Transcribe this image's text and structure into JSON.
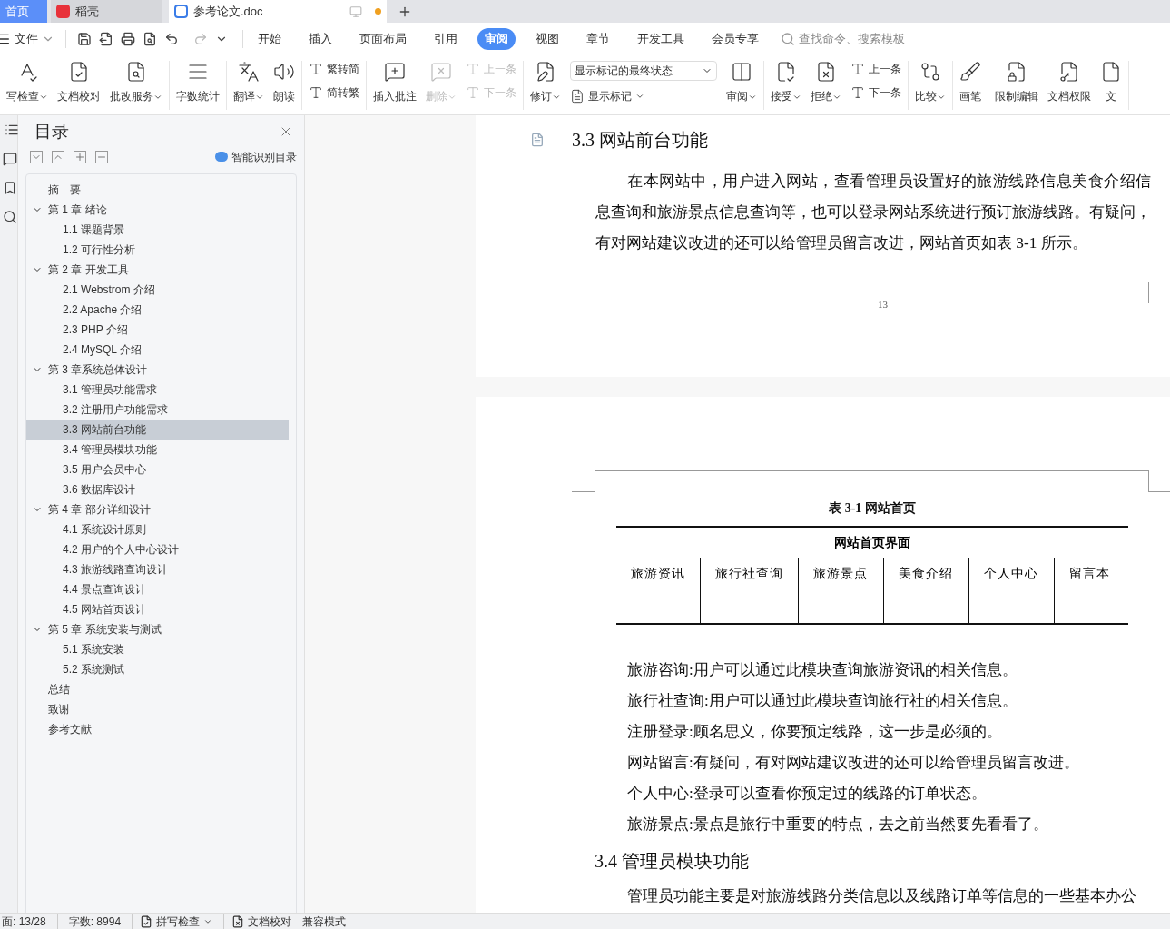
{
  "tabs": [
    {
      "label": "首页",
      "kind": "home",
      "selected": false
    },
    {
      "label": "稻壳",
      "kind": "app",
      "selected": false
    },
    {
      "label": "参考论文.doc",
      "kind": "doc",
      "selected": true
    }
  ],
  "menu": {
    "file": "文件",
    "tabs": [
      {
        "label": "开始",
        "selected": false
      },
      {
        "label": "插入",
        "selected": false
      },
      {
        "label": "页面布局",
        "selected": false
      },
      {
        "label": "引用",
        "selected": false
      },
      {
        "label": "审阅",
        "selected": true
      },
      {
        "label": "视图",
        "selected": false
      },
      {
        "label": "章节",
        "selected": false
      },
      {
        "label": "开发工具",
        "selected": false
      },
      {
        "label": "会员专享",
        "selected": false
      }
    ],
    "search": {
      "placeholder": "查找命令、搜索模板"
    }
  },
  "ribbon": [
    [
      {
        "kind": "big",
        "label": "写检查",
        "caret": true,
        "disabled": false
      },
      {
        "kind": "big",
        "label": "文档校对",
        "caret": false,
        "disabled": false
      },
      {
        "kind": "big",
        "label": "批改服务",
        "caret": true,
        "disabled": false
      }
    ],
    [
      {
        "kind": "big",
        "label": "字数统计",
        "caret": false,
        "disabled": false
      }
    ],
    [
      {
        "kind": "big",
        "label": "翻译",
        "caret": true,
        "disabled": false
      },
      {
        "kind": "big",
        "label": "朗读",
        "caret": false,
        "disabled": false
      }
    ],
    [
      {
        "kind": "stack",
        "items": [
          {
            "label": "繁转简",
            "disabled": false
          },
          {
            "label": "简转繁",
            "disabled": false
          }
        ]
      }
    ],
    [
      {
        "kind": "big",
        "label": "插入批注",
        "caret": false,
        "disabled": false
      },
      {
        "kind": "big",
        "label": "删除",
        "caret": true,
        "disabled": true
      },
      {
        "kind": "stack",
        "items": [
          {
            "label": "上一条",
            "disabled": true
          },
          {
            "label": "下一条",
            "disabled": true
          }
        ]
      }
    ],
    [
      {
        "kind": "big",
        "label": "修订",
        "caret": true,
        "disabled": false
      },
      {
        "kind": "select",
        "value": "显示标记的最终状态",
        "below": "显示标记"
      },
      {
        "kind": "big",
        "label": "审阅",
        "caret": true,
        "disabled": false
      }
    ],
    [
      {
        "kind": "big",
        "label": "接受",
        "caret": true,
        "disabled": false
      },
      {
        "kind": "big",
        "label": "拒绝",
        "caret": true,
        "disabled": false
      },
      {
        "kind": "stack",
        "items": [
          {
            "label": "上一条",
            "disabled": false
          },
          {
            "label": "下一条",
            "disabled": false
          }
        ]
      }
    ],
    [
      {
        "kind": "big",
        "label": "比较",
        "caret": true,
        "disabled": false
      }
    ],
    [
      {
        "kind": "big",
        "label": "画笔",
        "caret": false,
        "disabled": false
      }
    ],
    [
      {
        "kind": "big",
        "label": "限制编辑",
        "caret": false,
        "disabled": false
      },
      {
        "kind": "big",
        "label": "文档权限",
        "caret": false,
        "disabled": false
      },
      {
        "kind": "big",
        "label": "文",
        "caret": false,
        "disabled": false
      }
    ]
  ],
  "toc": {
    "title": "目录",
    "smart": "智能识别目录",
    "items": [
      {
        "label": "摘　要",
        "selected": false
      },
      {
        "label": "第 1 章  绪论",
        "expanded": true,
        "selected": false,
        "children": [
          {
            "label": "1.1  课题背景",
            "selected": false
          },
          {
            "label": "1.2  可行性分析",
            "selected": false
          }
        ]
      },
      {
        "label": "第 2 章  开发工具",
        "expanded": true,
        "selected": false,
        "children": [
          {
            "label": "2.1 Webstrom 介绍",
            "selected": false
          },
          {
            "label": "2.2 Apache 介绍",
            "selected": false
          },
          {
            "label": "2.3    PHP 介绍",
            "selected": false
          },
          {
            "label": "2.4 MySQL 介绍",
            "selected": false
          }
        ]
      },
      {
        "label": "第 3 章系统总体设计",
        "expanded": true,
        "selected": false,
        "children": [
          {
            "label": "3.1  管理员功能需求",
            "selected": false
          },
          {
            "label": "3.2  注册用户功能需求",
            "selected": false
          },
          {
            "label": "3.3  网站前台功能",
            "selected": true
          },
          {
            "label": "3.4  管理员模块功能",
            "selected": false
          },
          {
            "label": "3.5  用户会员中心",
            "selected": false
          },
          {
            "label": "3.6  数据库设计",
            "selected": false
          }
        ]
      },
      {
        "label": "第 4 章  部分详细设计",
        "expanded": true,
        "selected": false,
        "children": [
          {
            "label": "4.1  系统设计原则",
            "selected": false
          },
          {
            "label": "4.2  用户的个人中心设计",
            "selected": false
          },
          {
            "label": "4.3  旅游线路查询设计",
            "selected": false
          },
          {
            "label": "4.4  景点查询设计",
            "selected": false
          },
          {
            "label": "4.5  网站首页设计",
            "selected": false
          }
        ]
      },
      {
        "label": "第 5 章  系统安装与测试",
        "expanded": true,
        "selected": false,
        "children": [
          {
            "label": "5.1  系统安装",
            "selected": false
          },
          {
            "label": "5.2  系统测试",
            "selected": false
          }
        ]
      },
      {
        "label": "总结",
        "selected": false
      },
      {
        "label": "致谢",
        "selected": false
      },
      {
        "label": "参考文献",
        "selected": false
      }
    ]
  },
  "document": {
    "heading": "3.3  网站前台功能",
    "paragraph": "在本网站中，用户进入网站，查看管理员设置好的旅游线路信息美食介绍信息查询和旅游景点信息查询等，也可以登录网站系统进行预订旅游线路。有疑问，有对网站建议改进的还可以给管理员留言改进，网站首页如表 3-1 所示。",
    "page_number": "13",
    "table": {
      "caption": "表 3-1  网站首页",
      "header": "网站首页界面",
      "cells": [
        "旅游资讯",
        "旅行社查询",
        "旅游景点",
        "美食介绍",
        "个人中心",
        "留言本"
      ]
    },
    "lines": [
      "旅游咨询:用户可以通过此模块查询旅游资讯的相关信息。",
      "旅行社查询:用户可以通过此模块查询旅行社的相关信息。",
      "注册登录:顾名思义，你要预定线路，这一步是必须的。",
      "网站留言:有疑问，有对网站建议改进的还可以给管理员留言改进。",
      "个人中心:登录可以查看你预定过的线路的订单状态。",
      "旅游景点:景点是旅行中重要的特点，去之前当然要先看看了。"
    ],
    "heading2": "3.4  管理员模块功能",
    "cut_line": "管理员功能主要是对旅游线路分类信息以及线路订单等信息的一些基本办公"
  },
  "status": {
    "page": "面: 13/28",
    "words": "字数: 8994",
    "spell": "拼写检查",
    "proof": "文档校对",
    "mode": "兼容模式"
  }
}
